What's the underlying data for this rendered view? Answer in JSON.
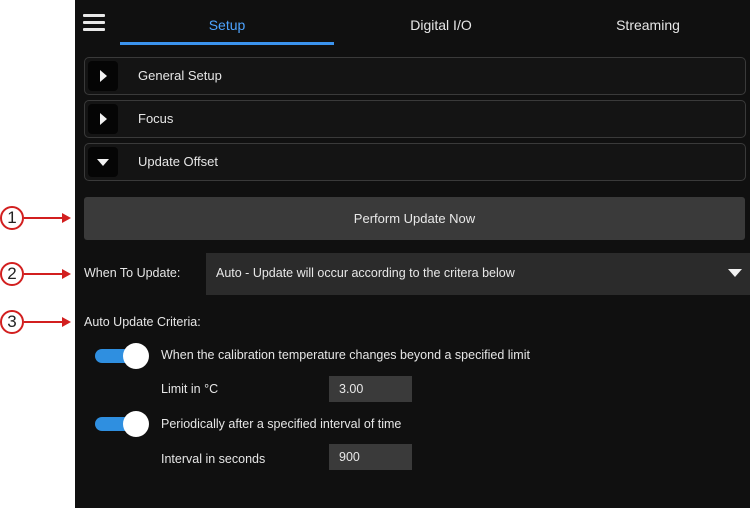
{
  "tabs": [
    {
      "label": "Setup",
      "active": true
    },
    {
      "label": "Digital I/O",
      "active": false
    },
    {
      "label": "Streaming",
      "active": false
    }
  ],
  "sections": [
    {
      "label": "General Setup",
      "expanded": false
    },
    {
      "label": "Focus",
      "expanded": false
    },
    {
      "label": "Update Offset",
      "expanded": true
    }
  ],
  "perform_button": "Perform Update Now",
  "when_to_update": {
    "label": "When To Update:",
    "value": "Auto - Update will occur according to the critera below"
  },
  "criteria": {
    "label": "Auto Update Criteria:",
    "items": [
      {
        "text": "When the calibration temperature changes beyond a specified limit",
        "enabled": true,
        "field_label": "Limit in °C",
        "field_value": "3.00"
      },
      {
        "text": "Periodically after a specified interval of time",
        "enabled": true,
        "field_label": "Interval in seconds",
        "field_value": "900"
      }
    ]
  },
  "callouts": [
    "1",
    "2",
    "3"
  ],
  "colors": {
    "accent": "#3b93ee",
    "background": "#101010",
    "callout": "#d21f1f"
  }
}
